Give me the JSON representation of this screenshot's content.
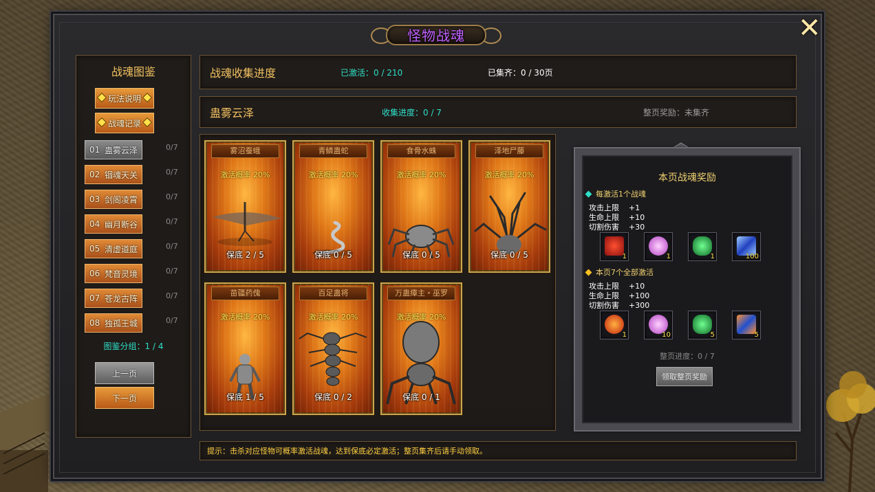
{
  "window": {
    "title": "怪物战魂",
    "close_icon": "close-x-icon"
  },
  "left": {
    "title": "战魂图鉴",
    "rules_button": "玩法说明",
    "log_button": "战魂记录",
    "categories": [
      {
        "num": "01",
        "name": "蛊雾云泽",
        "count": "0/7",
        "selected": true
      },
      {
        "num": "02",
        "name": "锢魂天关",
        "count": "0/7"
      },
      {
        "num": "03",
        "name": "剑阁凌霄",
        "count": "0/7"
      },
      {
        "num": "04",
        "name": "幽月断谷",
        "count": "0/7"
      },
      {
        "num": "05",
        "name": "清虚道庭",
        "count": "0/7"
      },
      {
        "num": "06",
        "name": "梵音灵境",
        "count": "0/7"
      },
      {
        "num": "07",
        "name": "苍龙古阵",
        "count": "0/7"
      },
      {
        "num": "08",
        "name": "独孤王城",
        "count": "0/7"
      }
    ],
    "group_label": "图鉴分组：1 / 4",
    "prev_button": "上一页",
    "next_button": "下一页"
  },
  "summary": {
    "title": "战魂收集进度",
    "activated": "已激活：0 / 210",
    "collected": "已集齐：0 / 30页"
  },
  "page": {
    "title": "蛊雾云泽",
    "progress": "收集进度：0 / 7",
    "page_reward": "整页奖励：未集齐"
  },
  "cards": [
    {
      "name": "雾沼蚕蛾",
      "rate": "激活概率 20%",
      "guarantee": "保底 2 / 5",
      "icon": "moth-creature-icon"
    },
    {
      "name": "青鳞蛊蛇",
      "rate": "激活概率 20%",
      "guarantee": "保底 0 / 5",
      "icon": "serpent-creature-icon"
    },
    {
      "name": "食骨水蛛",
      "rate": "激活概率 20%",
      "guarantee": "保底 0 / 5",
      "icon": "spider-creature-icon"
    },
    {
      "name": "泽地尸藤",
      "rate": "激活概率 20%",
      "guarantee": "保底 0 / 5",
      "icon": "vine-creature-icon"
    },
    {
      "name": "苗疆药傀",
      "rate": "激活概率 20%",
      "guarantee": "保底 1 / 5",
      "icon": "puppet-creature-icon"
    },
    {
      "name": "百足蛊将",
      "rate": "激活概率 20%",
      "guarantee": "保底 0 / 2",
      "icon": "centipede-creature-icon"
    },
    {
      "name": "万蛊瘴主・巫罗",
      "rate": "激活概率 20%",
      "guarantee": "保底 0 / 1",
      "icon": "boss-scorpion-icon"
    }
  ],
  "rewards": {
    "title": "本页战魂奖励",
    "per_activation": {
      "label": "每激活1个战魂",
      "stats": [
        {
          "name": "攻击上限",
          "value": "+1"
        },
        {
          "name": "生命上限",
          "value": "+10"
        },
        {
          "name": "切割伤害",
          "value": "+30"
        }
      ],
      "items": [
        {
          "icon": "red-book-icon",
          "count": "1",
          "color": "#c8201a"
        },
        {
          "icon": "pink-orb-icon",
          "count": "1",
          "color": "#e080e0"
        },
        {
          "icon": "jade-toad-icon",
          "count": "1",
          "color": "#28b050"
        },
        {
          "icon": "blue-crystal-icon",
          "count": "100",
          "color": "#4070e0"
        }
      ]
    },
    "full_page": {
      "label": "本页7个全部激活",
      "stats": [
        {
          "name": "攻击上限",
          "value": "+10"
        },
        {
          "name": "生命上限",
          "value": "+100"
        },
        {
          "name": "切割伤害",
          "value": "+300"
        }
      ],
      "items": [
        {
          "icon": "red-token-icon",
          "count": "1",
          "color": "#e03018"
        },
        {
          "icon": "pink-orb-icon",
          "count": "10",
          "color": "#e080e0"
        },
        {
          "icon": "jade-toad-icon",
          "count": "5",
          "color": "#28b050"
        },
        {
          "icon": "blue-orange-gem-icon",
          "count": "5",
          "color": "#3060d0"
        }
      ]
    },
    "page_progress": "整页进度：0 / 7",
    "claim_button": "领取整页奖励"
  },
  "tip": "提示：击杀对应怪物可概率激活战魂，达到保底必定激活；整页集齐后请手动领取。",
  "colors": {
    "accent_gold": "#f0c060",
    "accent_cyan": "#2ee0c8",
    "title_purple": "#c060ff"
  }
}
